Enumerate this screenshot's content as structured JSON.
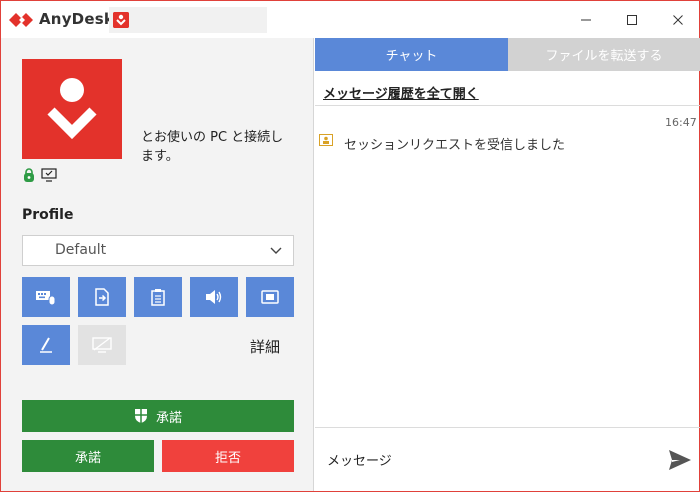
{
  "window": {
    "title": "AnyDesk",
    "id_value": "",
    "controls": {
      "minimize": "—",
      "maximize": "☐",
      "close": "✕"
    }
  },
  "left": {
    "connect_text": "とお使いの PC と接続します。",
    "profile_label": "Profile",
    "profile_value": "Default",
    "permissions": [
      {
        "icon": "keyboard-mouse-icon",
        "enabled": true
      },
      {
        "icon": "file-transfer-icon",
        "enabled": true
      },
      {
        "icon": "clipboard-icon",
        "enabled": true
      },
      {
        "icon": "speaker-icon",
        "enabled": true
      },
      {
        "icon": "camera-icon",
        "enabled": true
      },
      {
        "icon": "pen-icon",
        "enabled": true
      },
      {
        "icon": "screen-lock-icon",
        "enabled": false
      }
    ],
    "details_label": "詳細",
    "accept_elevated_label": "承諾",
    "accept_label": "承諾",
    "reject_label": "拒否"
  },
  "right": {
    "tabs": [
      {
        "label": "チャット",
        "active": true
      },
      {
        "label": "ファイルを転送する",
        "active": false
      }
    ],
    "history_link": "メッセージ履歴を全て開く",
    "messages": [
      {
        "time": "16:47",
        "text": "セッションリクエストを受信しました"
      }
    ],
    "input_placeholder": "メッセージ"
  },
  "colors": {
    "brand_red": "#e3322b",
    "tab_blue": "#5a88d8",
    "accept_green": "#2e8b3a",
    "reject_red": "#f0413d"
  }
}
